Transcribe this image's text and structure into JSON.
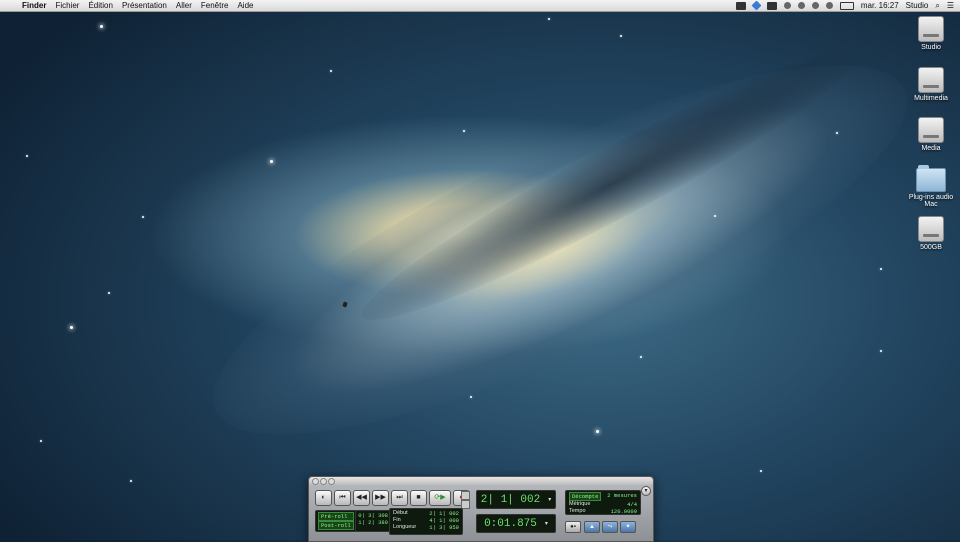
{
  "menubar": {
    "items": [
      "Finder",
      "Fichier",
      "Édition",
      "Présentation",
      "Aller",
      "Fenêtre",
      "Aide"
    ],
    "clock": "mar. 16:27",
    "user": "Studio"
  },
  "desktop": {
    "icons": [
      {
        "label": "Studio",
        "type": "drive"
      },
      {
        "label": "Multimedia",
        "type": "drive"
      },
      {
        "label": "Media",
        "type": "drive"
      },
      {
        "label": "Plug-ins audio Mac",
        "type": "folder"
      },
      {
        "label": "500GB",
        "type": "drive"
      }
    ]
  },
  "transport": {
    "buttons": [
      "online-icon",
      "return-to-zero-icon",
      "rewind-icon",
      "fast-forward-icon",
      "go-to-end-icon",
      "stop-icon",
      "loop-play-icon",
      "record-icon"
    ],
    "main_counter": "2| 1| 002",
    "sub_counter": "0:01.875",
    "preroll_label": "Pré-roll",
    "preroll_value": "0| 3| 308",
    "postroll_label": "Post-roll",
    "postroll_value": "1| 2| 380",
    "start_label": "Début",
    "start_value": "2| 1| 002",
    "end_label": "Fin",
    "end_value": "4| 1| 000",
    "length_label": "Longueur",
    "length_value": "1| 3| 959",
    "countoff_label": "Décompte",
    "countoff_value": "2 mesures",
    "meter_label": "Métrique",
    "meter_value": "4/4",
    "tempo_label": "Tempo",
    "tempo_value": "120.0000"
  }
}
